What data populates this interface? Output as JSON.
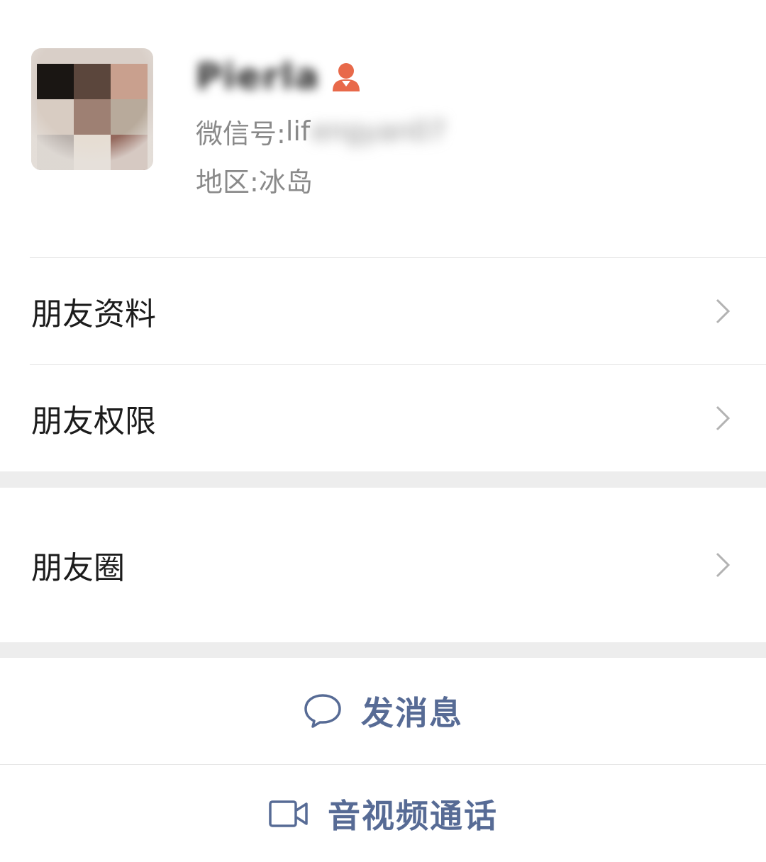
{
  "profile": {
    "name": "Pierla",
    "wechat_id_label": "微信号: ",
    "wechat_id_visible": "lif",
    "wechat_id_hidden": "engyan07",
    "region_label": "地区: ",
    "region_value": "冰岛",
    "contact_icon": "contact-person-icon",
    "contact_icon_color": "#e8694a"
  },
  "menu": {
    "friend_info": "朋友资料",
    "friend_permissions": "朋友权限",
    "moments": "朋友圈"
  },
  "actions": {
    "send_message": "发消息",
    "video_call": "音视频通话",
    "link_color": "#576b95"
  }
}
